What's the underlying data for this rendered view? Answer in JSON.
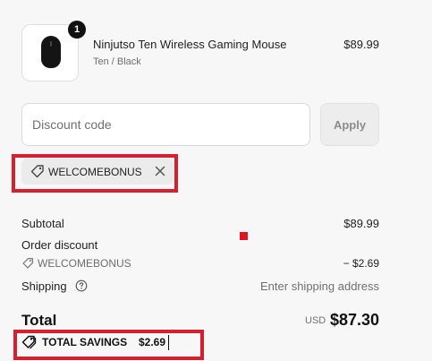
{
  "product": {
    "name": "Ninjutso Ten Wireless Gaming Mouse",
    "variant": "Ten / Black",
    "price": "$89.99",
    "quantity": "1",
    "image_icon": "mouse-icon"
  },
  "discount": {
    "input_placeholder": "Discount code",
    "input_value": "",
    "apply_label": "Apply",
    "applied_code": "WELCOMEBONUS",
    "remove_icon": "close-icon"
  },
  "summary": {
    "subtotal_label": "Subtotal",
    "subtotal_value": "$89.99",
    "order_discount_label": "Order discount",
    "discount_code": "WELCOMEBONUS",
    "discount_value": "− $2.69",
    "shipping_label": "Shipping",
    "shipping_value": "Enter shipping address",
    "total_label": "Total",
    "currency": "USD",
    "total_value": "$87.30",
    "savings_label": "TOTAL SAVINGS",
    "savings_value": "$2.69"
  },
  "colors": {
    "highlight": "#d62030",
    "marker": "#e0131e"
  }
}
